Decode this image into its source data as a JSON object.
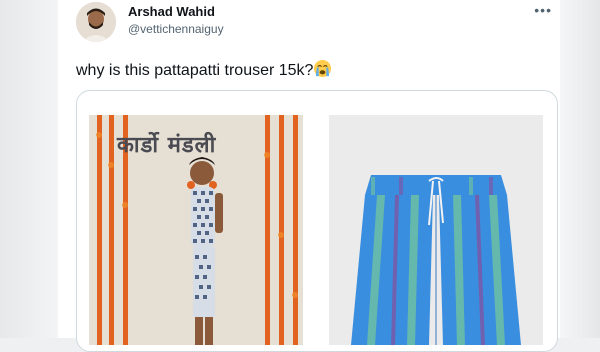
{
  "tweet": {
    "author_name": "Arshad Wahid",
    "author_handle": "@vettichennaiguy",
    "text": "why is this pattapatti trouser 15k?",
    "emoji": "loudly-crying-face"
  },
  "media": {
    "left_banner_text": "कार्डो मंडली"
  },
  "icons": {
    "more": "more-horizontal-icon"
  },
  "colors": {
    "text_primary": "#0f1419",
    "text_secondary": "#536471",
    "border": "#cfd9de",
    "short_blue": "#3a8ee0",
    "short_green": "#6cc0a4",
    "short_purple": "#7a5aa8"
  }
}
